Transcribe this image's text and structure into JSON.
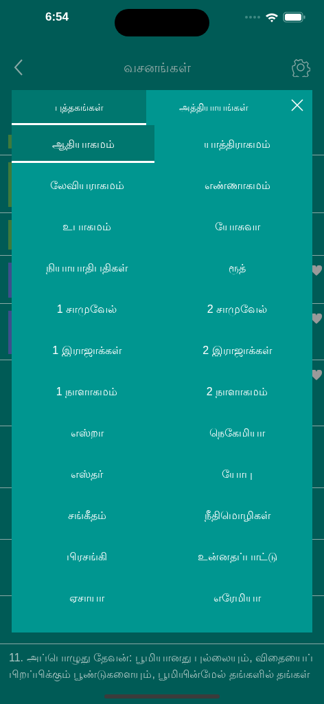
{
  "status_bar": {
    "time": "6:54"
  },
  "nav": {
    "title": "வசனங்கள்"
  },
  "verse_rows": [
    {
      "color": "#3f7a3c",
      "favorite": false
    },
    {
      "color": "#3f7a3c",
      "favorite": false
    },
    {
      "color": "#3f7a3c",
      "favorite": false
    },
    {
      "color": "#3d4f8c",
      "favorite": true
    },
    {
      "color": "#3d4f8c",
      "favorite": true
    },
    {
      "favorite": true
    },
    {
      "favorite": false
    },
    {
      "favorite": false
    },
    {
      "favorite": false
    },
    {
      "favorite": false
    }
  ],
  "last_verse": {
    "text": "11. அப்பொழுது தேவன்: பூமியானது புல்லையும், விதையைப் பிறப்பிக்கும் பூண்டுகளையும், பூமியின்மேல் தங்களில் தங்கள்"
  },
  "picker": {
    "tabs": [
      {
        "label": "புத்தகங்கள்",
        "selected": true
      },
      {
        "label": "அத்தியாயங்கள்",
        "selected": false
      }
    ],
    "books": [
      {
        "label": "ஆதியாகமம்",
        "selected": true
      },
      {
        "label": "யாத்திராகமம்",
        "selected": false
      },
      {
        "label": "லேவியராகமம்",
        "selected": false
      },
      {
        "label": "எண்ணாகமம்",
        "selected": false
      },
      {
        "label": "உபாகமம்",
        "selected": false
      },
      {
        "label": "யோசுவா",
        "selected": false
      },
      {
        "label": "நியாயாதிபதிகள்",
        "selected": false
      },
      {
        "label": "ரூத்",
        "selected": false
      },
      {
        "label": "1 சாமுவேல்",
        "selected": false
      },
      {
        "label": "2 சாமுவேல்",
        "selected": false
      },
      {
        "label": "1 இராஜாக்கள்",
        "selected": false
      },
      {
        "label": "2 இராஜாக்கள்",
        "selected": false
      },
      {
        "label": "1 நாளாகமம்",
        "selected": false
      },
      {
        "label": "2 நாளாகமம்",
        "selected": false
      },
      {
        "label": "எஸ்றா",
        "selected": false
      },
      {
        "label": "நெகேமியா",
        "selected": false
      },
      {
        "label": "எஸ்தர்",
        "selected": false
      },
      {
        "label": "யோபு",
        "selected": false
      },
      {
        "label": "சங்கீதம்",
        "selected": false
      },
      {
        "label": "நீதிமொழிகள்",
        "selected": false
      },
      {
        "label": "பிரசங்கி",
        "selected": false
      },
      {
        "label": "உன்னதப்பாட்டு",
        "selected": false
      },
      {
        "label": "ஏசாயா",
        "selected": false
      },
      {
        "label": "எரேமியா",
        "selected": false
      }
    ]
  }
}
